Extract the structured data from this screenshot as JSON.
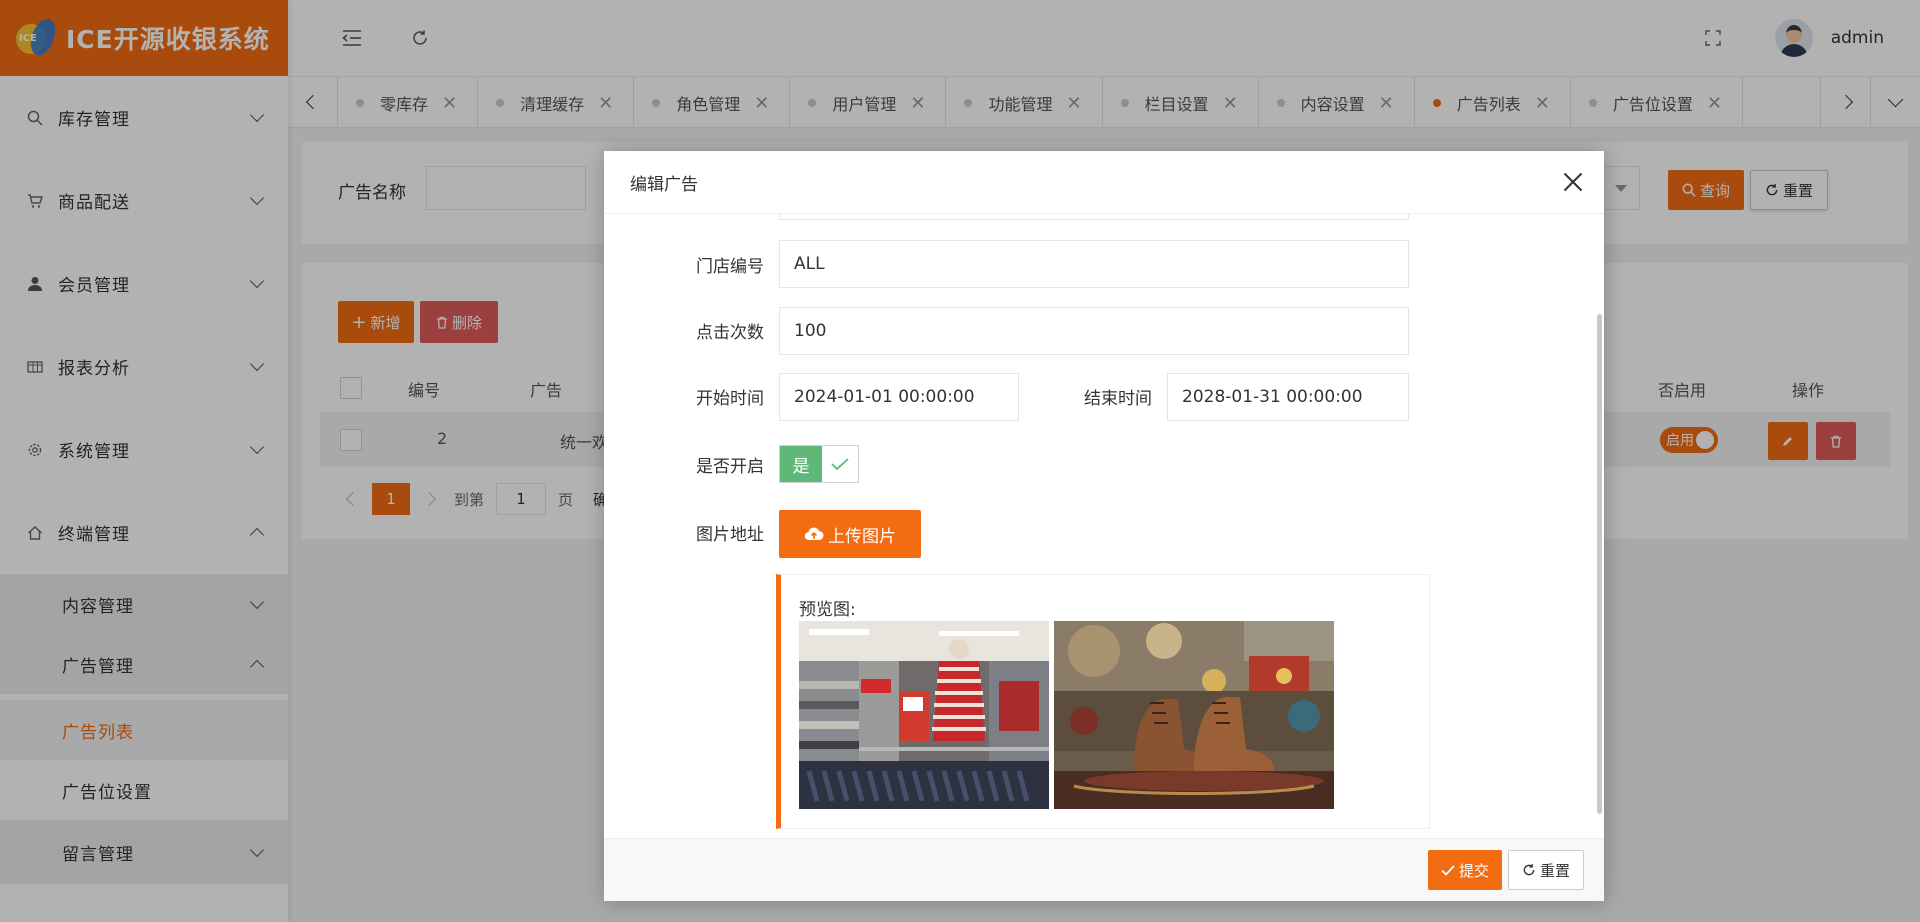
{
  "app": {
    "title": "ICE开源收银系统"
  },
  "sidebar": {
    "items": [
      {
        "label": "库存管理"
      },
      {
        "label": "商品配送"
      },
      {
        "label": "会员管理"
      },
      {
        "label": "报表分析"
      },
      {
        "label": "系统管理"
      },
      {
        "label": "终端管理"
      }
    ],
    "terminal_sub": [
      {
        "label": "内容管理"
      },
      {
        "label": "广告管理"
      },
      {
        "label": "留言管理"
      }
    ],
    "ad_leaves": [
      {
        "label": "广告列表"
      },
      {
        "label": "广告位设置"
      }
    ]
  },
  "header": {
    "username": "admin"
  },
  "tabs": [
    {
      "label": "零库存"
    },
    {
      "label": "清理缓存"
    },
    {
      "label": "角色管理"
    },
    {
      "label": "用户管理"
    },
    {
      "label": "功能管理"
    },
    {
      "label": "栏目设置"
    },
    {
      "label": "内容设置"
    },
    {
      "label": "广告列表"
    },
    {
      "label": "广告位设置"
    }
  ],
  "search": {
    "name_label": "广告名称",
    "query_label": "查询",
    "reset_label": "重置"
  },
  "toolbar": {
    "add_label": "新增",
    "delete_label": "删除"
  },
  "table": {
    "headers": {
      "id": "编号",
      "name": "广告",
      "enabled": "否启用",
      "ops": "操作"
    },
    "row": {
      "id": "2",
      "name": "统一欢",
      "status": "启用"
    }
  },
  "pager": {
    "current": "1",
    "goto_label": "到第",
    "page_input": "1",
    "page_label": "页",
    "confirm": "确"
  },
  "modal": {
    "title": "编辑广告",
    "store_code_label": "门店编号",
    "store_code": "ALL",
    "clicks_label": "点击次数",
    "clicks": "100",
    "start_label": "开始时间",
    "start_time": "2024-01-01 00:00:00",
    "end_label": "结束时间",
    "end_time": "2028-01-31 00:00:00",
    "enabled_label": "是否开启",
    "enabled_value": "是",
    "image_label": "图片地址",
    "upload_label": "上传图片",
    "preview_label": "预览图:",
    "submit_label": "提交",
    "reset_label": "重置"
  },
  "colors": {
    "accent": "#f26c12",
    "danger": "#e05b5b",
    "success": "#5fb878"
  }
}
